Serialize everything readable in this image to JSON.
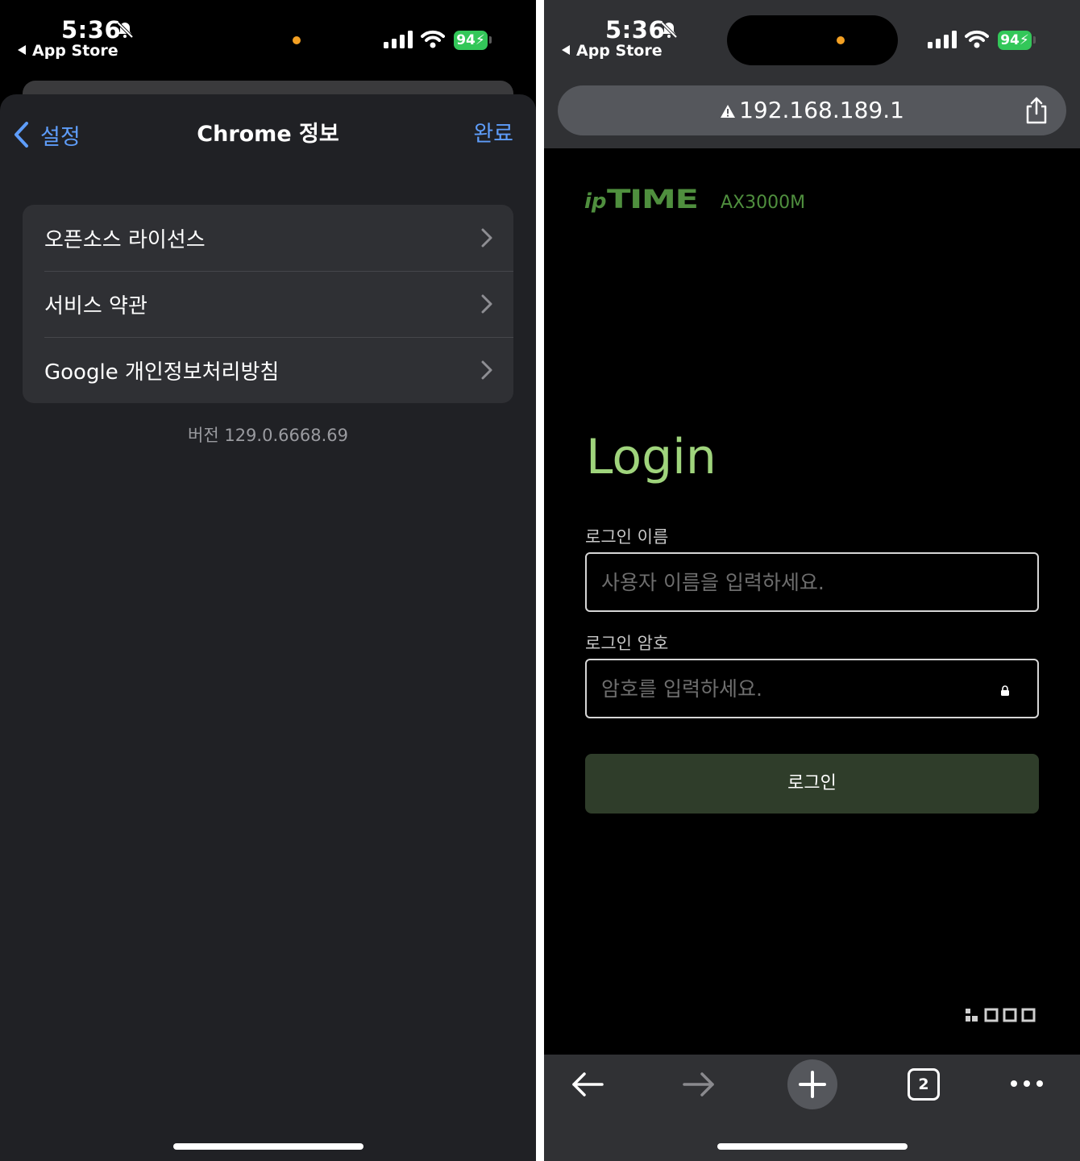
{
  "status": {
    "time": "5:36",
    "back_app": "App Store",
    "battery": "94"
  },
  "settings": {
    "back_label": "설정",
    "title": "Chrome 정보",
    "done_label": "완료",
    "items": [
      {
        "label": "오픈소스 라이선스"
      },
      {
        "label": "서비스 약관"
      },
      {
        "label": "Google 개인정보처리방침"
      }
    ],
    "version": "버전 129.0.6668.69"
  },
  "browser": {
    "url": "192.168.189.1",
    "tab_count": "2"
  },
  "router_page": {
    "brand_ip": "ip",
    "brand_time": "TIME",
    "model": "AX3000M",
    "title": "Login",
    "username_label": "로그인 이름",
    "username_placeholder": "사용자 이름을 입력하세요.",
    "password_label": "로그인 암호",
    "password_placeholder": "암호를 입력하세요.",
    "login_button": "로그인"
  },
  "colors": {
    "accent_blue": "#5e9dfa",
    "brand_green": "#4f8f3e",
    "login_green": "#9fd47c",
    "battery_green": "#33c759",
    "status_dot": "#f3a023"
  }
}
